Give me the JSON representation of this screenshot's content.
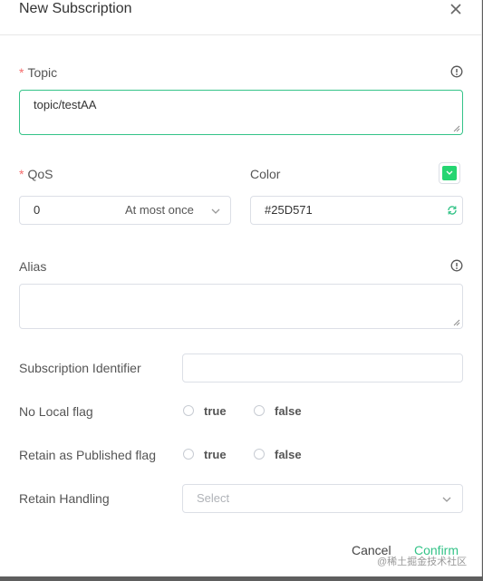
{
  "dialog": {
    "title": "New Subscription"
  },
  "topic": {
    "required_mark": "*",
    "label": "Topic",
    "value": "topic/testAA"
  },
  "qos": {
    "required_mark": "*",
    "label": "QoS",
    "value": "0",
    "description": "At most once"
  },
  "color": {
    "label": "Color",
    "value": "#25D571",
    "swatch": "#25D571"
  },
  "alias": {
    "label": "Alias",
    "value": ""
  },
  "subscription_identifier": {
    "label": "Subscription Identifier",
    "value": ""
  },
  "no_local": {
    "label": "No Local flag",
    "options": [
      "true",
      "false"
    ]
  },
  "retain_as_published": {
    "label": "Retain as Published flag",
    "options": [
      "true",
      "false"
    ]
  },
  "retain_handling": {
    "label": "Retain Handling",
    "placeholder": "Select"
  },
  "footer": {
    "cancel_label": "Cancel",
    "confirm_label": "Confirm"
  },
  "watermark": "@稀土掘金技术社区",
  "colors": {
    "accent": "#34C388",
    "required": "#F56C6C"
  }
}
